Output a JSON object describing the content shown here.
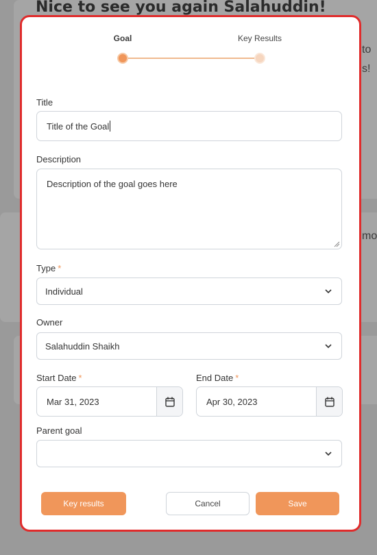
{
  "background": {
    "heading": "Nice to see you again Salahuddin!",
    "side_text_1": "to",
    "side_text_2": "s!",
    "side_text_3": "mo"
  },
  "stepper": {
    "steps": [
      {
        "label": "Goal",
        "active": true
      },
      {
        "label": "Key Results",
        "active": false
      }
    ]
  },
  "form": {
    "title": {
      "label": "Title",
      "value": "Title of the Goal"
    },
    "description": {
      "label": "Description",
      "value": "Description of the goal goes here"
    },
    "type": {
      "label": "Type",
      "required_mark": "*",
      "value": "Individual"
    },
    "owner": {
      "label": "Owner",
      "value": "Salahuddin Shaikh"
    },
    "start_date": {
      "label": "Start Date",
      "required_mark": "*",
      "value": "Mar 31, 2023"
    },
    "end_date": {
      "label": "End Date",
      "required_mark": "*",
      "value": "Apr 30, 2023"
    },
    "parent_goal": {
      "label": "Parent goal",
      "value": ""
    }
  },
  "actions": {
    "key_results": "Key results",
    "cancel": "Cancel",
    "save": "Save"
  },
  "colors": {
    "accent": "#f0965a",
    "highlight_border": "#e02b2b"
  },
  "icons": {
    "calendar": "calendar-icon",
    "chevron": "chevron-down-icon",
    "resize": "resize-handle-icon"
  }
}
